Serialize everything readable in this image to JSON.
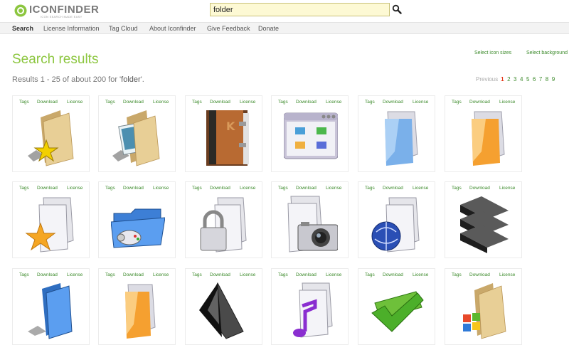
{
  "header": {
    "logo_text": "ICONFINDER",
    "logo_tagline": "ICON SEARCH MADE EASY",
    "search_value": "folder",
    "search_button_icon": "magnifier-icon"
  },
  "nav": {
    "items": [
      {
        "label": "Search",
        "active": true
      },
      {
        "label": "License Information",
        "active": false
      },
      {
        "label": "Tag Cloud",
        "active": false
      },
      {
        "label": "About Iconfinder",
        "active": false
      },
      {
        "label": "Give Feedback",
        "active": false
      },
      {
        "label": "Donate",
        "active": false
      }
    ]
  },
  "results": {
    "title": "Search results",
    "select_sizes": "Select icon sizes",
    "select_background": "Select background",
    "summary_prefix": "Results 1 - 25 of about 200 for '",
    "query": "folder",
    "summary_suffix": "'."
  },
  "pagination": {
    "previous": "Previous",
    "pages": [
      "1",
      "2",
      "3",
      "4",
      "5",
      "6",
      "7",
      "8",
      "9"
    ],
    "current": "1"
  },
  "card_links": {
    "tags": "Tags",
    "download": "Download",
    "license": "License"
  },
  "icons": [
    {
      "name": "folder-star-icon"
    },
    {
      "name": "folder-pictures-icon"
    },
    {
      "name": "kde-book-icon"
    },
    {
      "name": "window-folders-icon"
    },
    {
      "name": "blue-glass-folder-icon"
    },
    {
      "name": "orange-glass-folder-icon"
    },
    {
      "name": "white-folder-star-icon"
    },
    {
      "name": "folder-gamepad-icon"
    },
    {
      "name": "folder-lock-icon"
    },
    {
      "name": "folder-camera-icon"
    },
    {
      "name": "folder-globe-icon"
    },
    {
      "name": "black-binders-stack-icon"
    },
    {
      "name": "blue-folder-icon"
    },
    {
      "name": "orange-folder-icon"
    },
    {
      "name": "black-glass-folder-icon"
    },
    {
      "name": "folder-music-icon"
    },
    {
      "name": "green-check-folder-icon"
    },
    {
      "name": "folder-windows-icon"
    }
  ],
  "colors": {
    "accent_green": "#8cc63f",
    "link_green": "#3b8a2a",
    "current_page_red": "#e5381a",
    "search_bg": "#fdf9d4"
  }
}
